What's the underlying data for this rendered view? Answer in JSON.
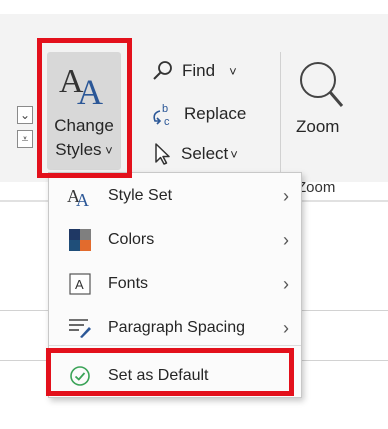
{
  "ribbon": {
    "change_styles_line1": "Change",
    "change_styles_line2": "Styles",
    "find_label": "Find",
    "replace_label": "Replace",
    "select_label": "Select",
    "zoom_label": "Zoom",
    "zoom_group_label": "Zoom"
  },
  "menu": {
    "items": [
      {
        "label": "Style Set",
        "icon": "style-set-icon",
        "has_submenu": true
      },
      {
        "label": "Colors",
        "icon": "colors-icon",
        "has_submenu": true
      },
      {
        "label": "Fonts",
        "icon": "fonts-icon",
        "has_submenu": true
      },
      {
        "label": "Paragraph Spacing",
        "icon": "paragraph-spacing-icon",
        "has_submenu": true
      },
      {
        "label": "Set as Default",
        "icon": "checkmark-circle-icon",
        "has_submenu": false
      }
    ]
  },
  "colors": {
    "highlight_red": "#e3101b",
    "accent_blue": "#2b5797",
    "success_green": "#3aa357"
  }
}
